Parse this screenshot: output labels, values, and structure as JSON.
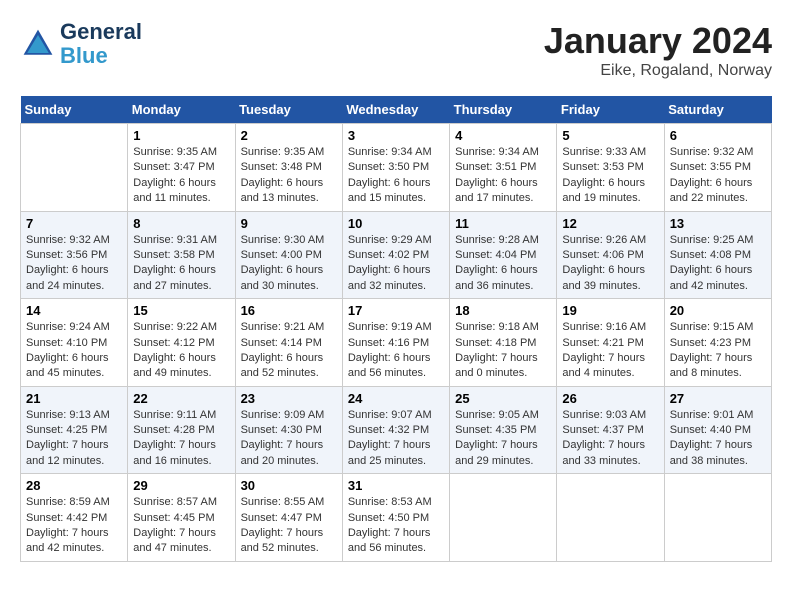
{
  "logo": {
    "line1": "General",
    "line2": "Blue"
  },
  "title": "January 2024",
  "subtitle": "Eike, Rogaland, Norway",
  "weekdays": [
    "Sunday",
    "Monday",
    "Tuesday",
    "Wednesday",
    "Thursday",
    "Friday",
    "Saturday"
  ],
  "weeks": [
    [
      {
        "day": "",
        "sunrise": "",
        "sunset": "",
        "daylight": ""
      },
      {
        "day": "1",
        "sunrise": "Sunrise: 9:35 AM",
        "sunset": "Sunset: 3:47 PM",
        "daylight": "Daylight: 6 hours and 11 minutes."
      },
      {
        "day": "2",
        "sunrise": "Sunrise: 9:35 AM",
        "sunset": "Sunset: 3:48 PM",
        "daylight": "Daylight: 6 hours and 13 minutes."
      },
      {
        "day": "3",
        "sunrise": "Sunrise: 9:34 AM",
        "sunset": "Sunset: 3:50 PM",
        "daylight": "Daylight: 6 hours and 15 minutes."
      },
      {
        "day": "4",
        "sunrise": "Sunrise: 9:34 AM",
        "sunset": "Sunset: 3:51 PM",
        "daylight": "Daylight: 6 hours and 17 minutes."
      },
      {
        "day": "5",
        "sunrise": "Sunrise: 9:33 AM",
        "sunset": "Sunset: 3:53 PM",
        "daylight": "Daylight: 6 hours and 19 minutes."
      },
      {
        "day": "6",
        "sunrise": "Sunrise: 9:32 AM",
        "sunset": "Sunset: 3:55 PM",
        "daylight": "Daylight: 6 hours and 22 minutes."
      }
    ],
    [
      {
        "day": "7",
        "sunrise": "Sunrise: 9:32 AM",
        "sunset": "Sunset: 3:56 PM",
        "daylight": "Daylight: 6 hours and 24 minutes."
      },
      {
        "day": "8",
        "sunrise": "Sunrise: 9:31 AM",
        "sunset": "Sunset: 3:58 PM",
        "daylight": "Daylight: 6 hours and 27 minutes."
      },
      {
        "day": "9",
        "sunrise": "Sunrise: 9:30 AM",
        "sunset": "Sunset: 4:00 PM",
        "daylight": "Daylight: 6 hours and 30 minutes."
      },
      {
        "day": "10",
        "sunrise": "Sunrise: 9:29 AM",
        "sunset": "Sunset: 4:02 PM",
        "daylight": "Daylight: 6 hours and 32 minutes."
      },
      {
        "day": "11",
        "sunrise": "Sunrise: 9:28 AM",
        "sunset": "Sunset: 4:04 PM",
        "daylight": "Daylight: 6 hours and 36 minutes."
      },
      {
        "day": "12",
        "sunrise": "Sunrise: 9:26 AM",
        "sunset": "Sunset: 4:06 PM",
        "daylight": "Daylight: 6 hours and 39 minutes."
      },
      {
        "day": "13",
        "sunrise": "Sunrise: 9:25 AM",
        "sunset": "Sunset: 4:08 PM",
        "daylight": "Daylight: 6 hours and 42 minutes."
      }
    ],
    [
      {
        "day": "14",
        "sunrise": "Sunrise: 9:24 AM",
        "sunset": "Sunset: 4:10 PM",
        "daylight": "Daylight: 6 hours and 45 minutes."
      },
      {
        "day": "15",
        "sunrise": "Sunrise: 9:22 AM",
        "sunset": "Sunset: 4:12 PM",
        "daylight": "Daylight: 6 hours and 49 minutes."
      },
      {
        "day": "16",
        "sunrise": "Sunrise: 9:21 AM",
        "sunset": "Sunset: 4:14 PM",
        "daylight": "Daylight: 6 hours and 52 minutes."
      },
      {
        "day": "17",
        "sunrise": "Sunrise: 9:19 AM",
        "sunset": "Sunset: 4:16 PM",
        "daylight": "Daylight: 6 hours and 56 minutes."
      },
      {
        "day": "18",
        "sunrise": "Sunrise: 9:18 AM",
        "sunset": "Sunset: 4:18 PM",
        "daylight": "Daylight: 7 hours and 0 minutes."
      },
      {
        "day": "19",
        "sunrise": "Sunrise: 9:16 AM",
        "sunset": "Sunset: 4:21 PM",
        "daylight": "Daylight: 7 hours and 4 minutes."
      },
      {
        "day": "20",
        "sunrise": "Sunrise: 9:15 AM",
        "sunset": "Sunset: 4:23 PM",
        "daylight": "Daylight: 7 hours and 8 minutes."
      }
    ],
    [
      {
        "day": "21",
        "sunrise": "Sunrise: 9:13 AM",
        "sunset": "Sunset: 4:25 PM",
        "daylight": "Daylight: 7 hours and 12 minutes."
      },
      {
        "day": "22",
        "sunrise": "Sunrise: 9:11 AM",
        "sunset": "Sunset: 4:28 PM",
        "daylight": "Daylight: 7 hours and 16 minutes."
      },
      {
        "day": "23",
        "sunrise": "Sunrise: 9:09 AM",
        "sunset": "Sunset: 4:30 PM",
        "daylight": "Daylight: 7 hours and 20 minutes."
      },
      {
        "day": "24",
        "sunrise": "Sunrise: 9:07 AM",
        "sunset": "Sunset: 4:32 PM",
        "daylight": "Daylight: 7 hours and 25 minutes."
      },
      {
        "day": "25",
        "sunrise": "Sunrise: 9:05 AM",
        "sunset": "Sunset: 4:35 PM",
        "daylight": "Daylight: 7 hours and 29 minutes."
      },
      {
        "day": "26",
        "sunrise": "Sunrise: 9:03 AM",
        "sunset": "Sunset: 4:37 PM",
        "daylight": "Daylight: 7 hours and 33 minutes."
      },
      {
        "day": "27",
        "sunrise": "Sunrise: 9:01 AM",
        "sunset": "Sunset: 4:40 PM",
        "daylight": "Daylight: 7 hours and 38 minutes."
      }
    ],
    [
      {
        "day": "28",
        "sunrise": "Sunrise: 8:59 AM",
        "sunset": "Sunset: 4:42 PM",
        "daylight": "Daylight: 7 hours and 42 minutes."
      },
      {
        "day": "29",
        "sunrise": "Sunrise: 8:57 AM",
        "sunset": "Sunset: 4:45 PM",
        "daylight": "Daylight: 7 hours and 47 minutes."
      },
      {
        "day": "30",
        "sunrise": "Sunrise: 8:55 AM",
        "sunset": "Sunset: 4:47 PM",
        "daylight": "Daylight: 7 hours and 52 minutes."
      },
      {
        "day": "31",
        "sunrise": "Sunrise: 8:53 AM",
        "sunset": "Sunset: 4:50 PM",
        "daylight": "Daylight: 7 hours and 56 minutes."
      },
      {
        "day": "",
        "sunrise": "",
        "sunset": "",
        "daylight": ""
      },
      {
        "day": "",
        "sunrise": "",
        "sunset": "",
        "daylight": ""
      },
      {
        "day": "",
        "sunrise": "",
        "sunset": "",
        "daylight": ""
      }
    ]
  ]
}
